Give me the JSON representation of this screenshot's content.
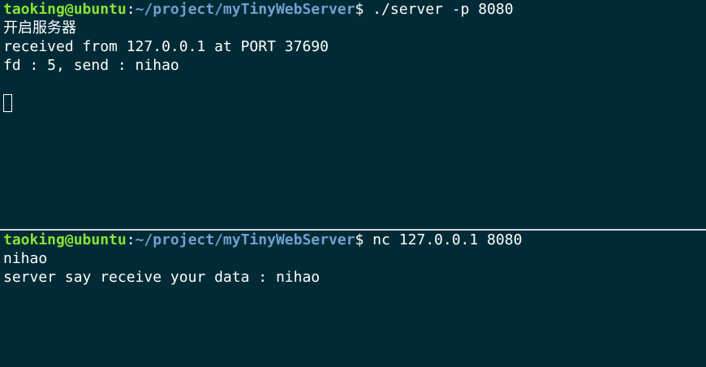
{
  "top_pane": {
    "prompt": {
      "user_host": "taoking@ubuntu",
      "separator": ":",
      "path": "~/project/myTinyWebServer",
      "dollar": "$",
      "command": " ./server -p 8080"
    },
    "output": [
      "开启服务器",
      "received from 127.0.0.1 at PORT 37690",
      "fd : 5, send : nihao"
    ]
  },
  "bottom_pane": {
    "prompt": {
      "user_host": "taoking@ubuntu",
      "separator": ":",
      "path": "~/project/myTinyWebServer",
      "dollar": "$",
      "command": " nc 127.0.0.1 8080"
    },
    "output": [
      "nihao",
      "server say receive your data : nihao"
    ]
  },
  "colors": {
    "background": "#002b36",
    "user_host": "#8ae234",
    "path": "#729fcf",
    "text": "#ffffff"
  }
}
